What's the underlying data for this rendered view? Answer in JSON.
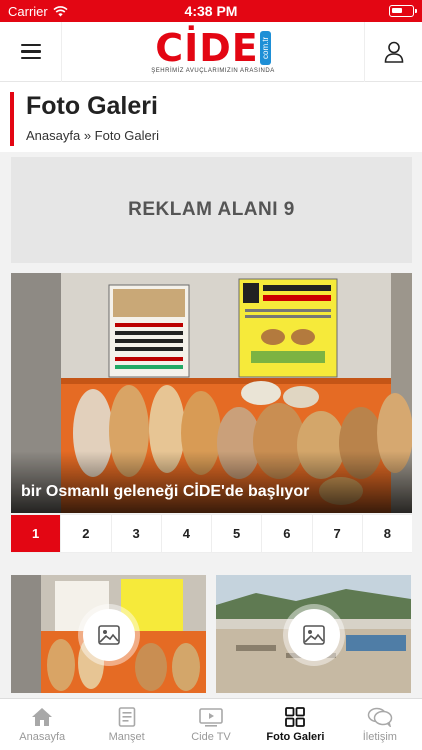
{
  "status": {
    "carrier": "Carrier",
    "time": "4:38 PM"
  },
  "header": {
    "logo_text": "CİDE",
    "logo_badge": "com.tr",
    "logo_tagline": "ŞEHRİMİZ AVUÇLARIMIZIN ARASINDA"
  },
  "page": {
    "title": "Foto Galeri",
    "breadcrumb": "Anasayfa » Foto Galeri"
  },
  "ad": {
    "label": "REKLAM ALANI 9"
  },
  "hero": {
    "caption": "bir Osmanlı geleneği CİDE'de başlıyor"
  },
  "pager": {
    "pages": [
      "1",
      "2",
      "3",
      "4",
      "5",
      "6",
      "7",
      "8"
    ],
    "active": "1"
  },
  "tabbar": {
    "tabs": [
      {
        "label": "Anasayfa",
        "icon": "home-icon"
      },
      {
        "label": "Manşet",
        "icon": "document-icon"
      },
      {
        "label": "Cide TV",
        "icon": "video-icon"
      },
      {
        "label": "Foto Galeri",
        "icon": "gallery-grid-icon"
      },
      {
        "label": "İletişim",
        "icon": "chat-icon"
      }
    ],
    "active": "Foto Galeri"
  },
  "colors": {
    "accent": "#e30613",
    "badge": "#1e8fd6"
  }
}
